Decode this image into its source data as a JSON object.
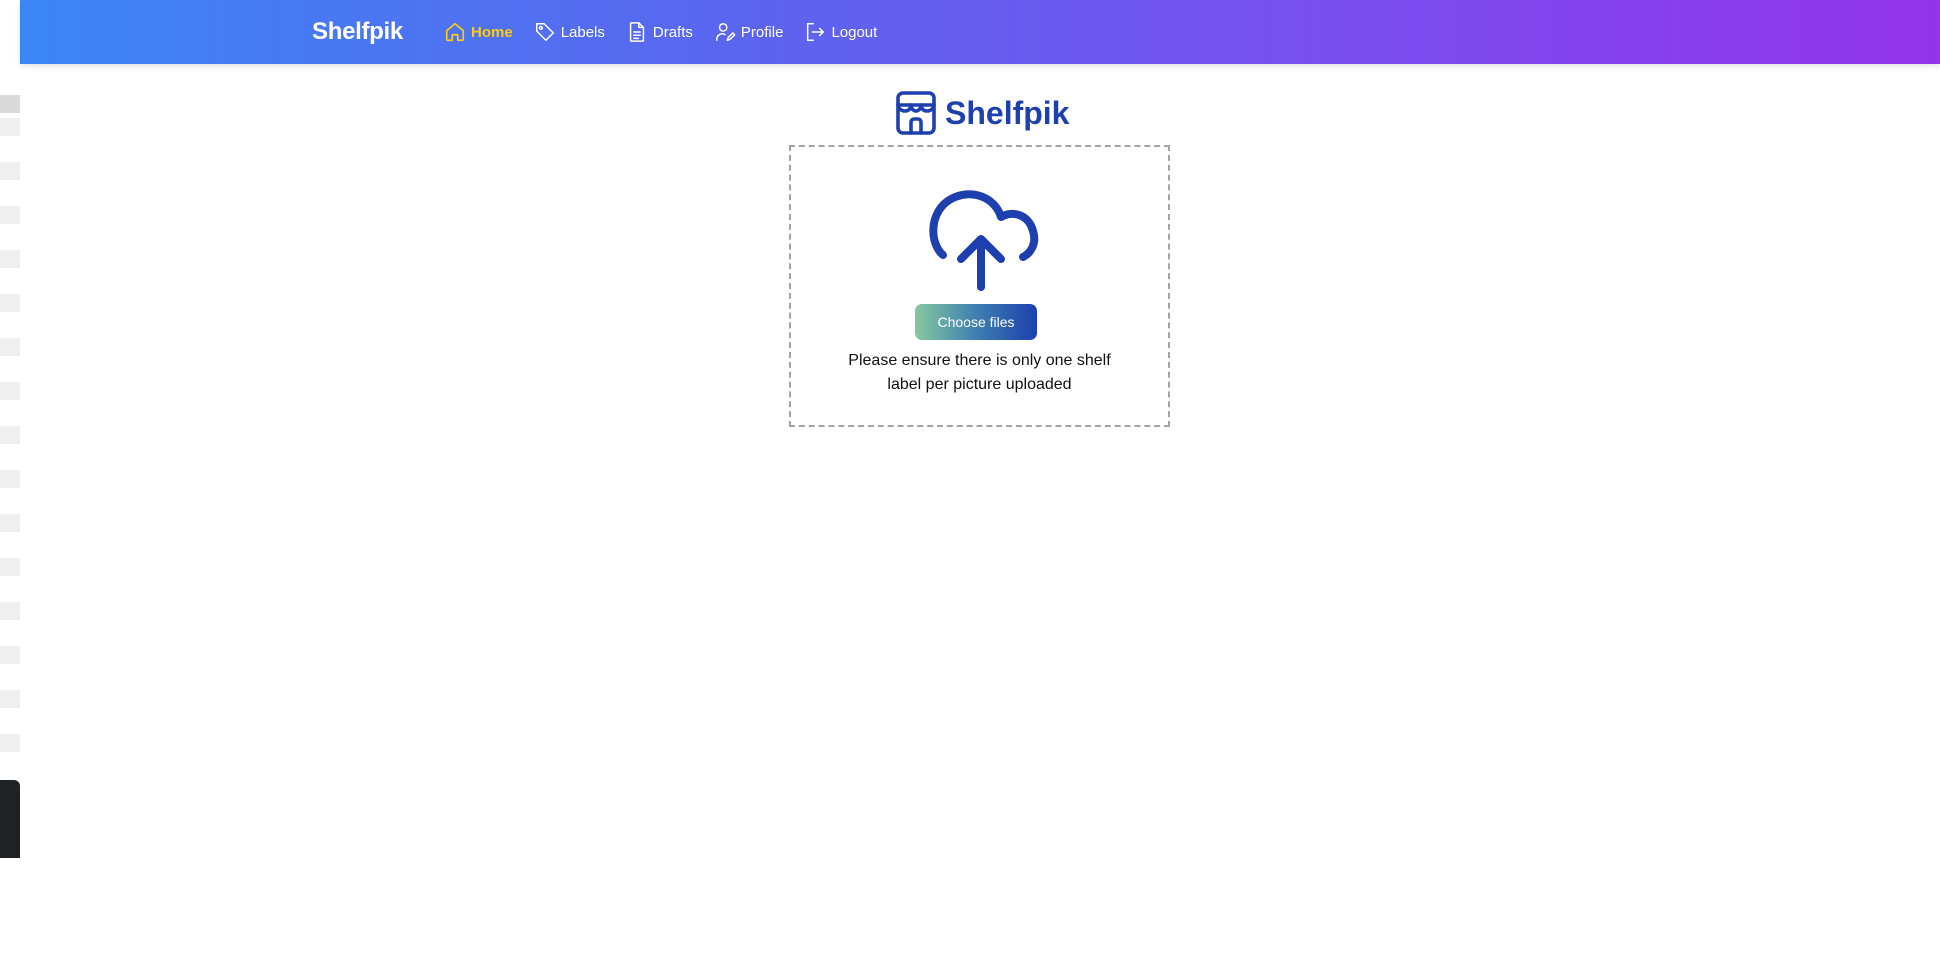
{
  "app": {
    "brand": "Shelfpik"
  },
  "nav": {
    "items": [
      {
        "label": "Home",
        "icon": "home-icon",
        "active": true
      },
      {
        "label": "Labels",
        "icon": "tag-icon",
        "active": false
      },
      {
        "label": "Drafts",
        "icon": "document-icon",
        "active": false
      },
      {
        "label": "Profile",
        "icon": "user-edit-icon",
        "active": false
      },
      {
        "label": "Logout",
        "icon": "logout-icon",
        "active": false
      }
    ]
  },
  "hero": {
    "title": "Shelfpik",
    "icon": "store-icon"
  },
  "upload": {
    "icon": "cloud-upload-icon",
    "button_label": "Choose files",
    "note_line1": "Please ensure there is only one shelf",
    "note_line2": "label per picture uploaded"
  },
  "colors": {
    "nav_gradient_start": "#3b86f6",
    "nav_gradient_end": "#9333ea",
    "active_nav": "#facc15",
    "brand_blue": "#1e40af"
  }
}
